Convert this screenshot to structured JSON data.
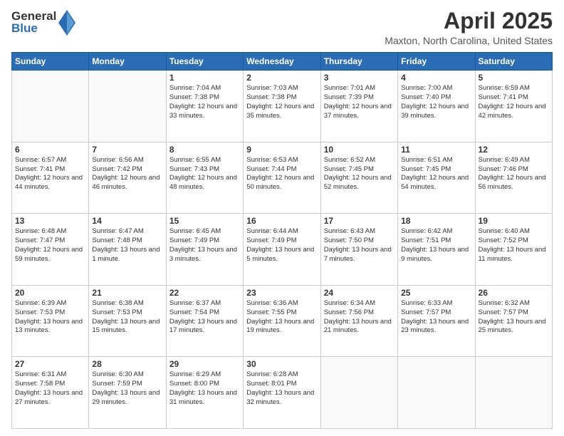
{
  "header": {
    "logo_general": "General",
    "logo_blue": "Blue",
    "title": "April 2025",
    "subtitle": "Maxton, North Carolina, United States"
  },
  "days_of_week": [
    "Sunday",
    "Monday",
    "Tuesday",
    "Wednesday",
    "Thursday",
    "Friday",
    "Saturday"
  ],
  "weeks": [
    [
      {
        "day": "",
        "info": ""
      },
      {
        "day": "",
        "info": ""
      },
      {
        "day": "1",
        "info": "Sunrise: 7:04 AM\nSunset: 7:38 PM\nDaylight: 12 hours and 33 minutes."
      },
      {
        "day": "2",
        "info": "Sunrise: 7:03 AM\nSunset: 7:38 PM\nDaylight: 12 hours and 35 minutes."
      },
      {
        "day": "3",
        "info": "Sunrise: 7:01 AM\nSunset: 7:39 PM\nDaylight: 12 hours and 37 minutes."
      },
      {
        "day": "4",
        "info": "Sunrise: 7:00 AM\nSunset: 7:40 PM\nDaylight: 12 hours and 39 minutes."
      },
      {
        "day": "5",
        "info": "Sunrise: 6:59 AM\nSunset: 7:41 PM\nDaylight: 12 hours and 42 minutes."
      }
    ],
    [
      {
        "day": "6",
        "info": "Sunrise: 6:57 AM\nSunset: 7:41 PM\nDaylight: 12 hours and 44 minutes."
      },
      {
        "day": "7",
        "info": "Sunrise: 6:56 AM\nSunset: 7:42 PM\nDaylight: 12 hours and 46 minutes."
      },
      {
        "day": "8",
        "info": "Sunrise: 6:55 AM\nSunset: 7:43 PM\nDaylight: 12 hours and 48 minutes."
      },
      {
        "day": "9",
        "info": "Sunrise: 6:53 AM\nSunset: 7:44 PM\nDaylight: 12 hours and 50 minutes."
      },
      {
        "day": "10",
        "info": "Sunrise: 6:52 AM\nSunset: 7:45 PM\nDaylight: 12 hours and 52 minutes."
      },
      {
        "day": "11",
        "info": "Sunrise: 6:51 AM\nSunset: 7:45 PM\nDaylight: 12 hours and 54 minutes."
      },
      {
        "day": "12",
        "info": "Sunrise: 6:49 AM\nSunset: 7:46 PM\nDaylight: 12 hours and 56 minutes."
      }
    ],
    [
      {
        "day": "13",
        "info": "Sunrise: 6:48 AM\nSunset: 7:47 PM\nDaylight: 12 hours and 59 minutes."
      },
      {
        "day": "14",
        "info": "Sunrise: 6:47 AM\nSunset: 7:48 PM\nDaylight: 13 hours and 1 minute."
      },
      {
        "day": "15",
        "info": "Sunrise: 6:45 AM\nSunset: 7:49 PM\nDaylight: 13 hours and 3 minutes."
      },
      {
        "day": "16",
        "info": "Sunrise: 6:44 AM\nSunset: 7:49 PM\nDaylight: 13 hours and 5 minutes."
      },
      {
        "day": "17",
        "info": "Sunrise: 6:43 AM\nSunset: 7:50 PM\nDaylight: 13 hours and 7 minutes."
      },
      {
        "day": "18",
        "info": "Sunrise: 6:42 AM\nSunset: 7:51 PM\nDaylight: 13 hours and 9 minutes."
      },
      {
        "day": "19",
        "info": "Sunrise: 6:40 AM\nSunset: 7:52 PM\nDaylight: 13 hours and 11 minutes."
      }
    ],
    [
      {
        "day": "20",
        "info": "Sunrise: 6:39 AM\nSunset: 7:53 PM\nDaylight: 13 hours and 13 minutes."
      },
      {
        "day": "21",
        "info": "Sunrise: 6:38 AM\nSunset: 7:53 PM\nDaylight: 13 hours and 15 minutes."
      },
      {
        "day": "22",
        "info": "Sunrise: 6:37 AM\nSunset: 7:54 PM\nDaylight: 13 hours and 17 minutes."
      },
      {
        "day": "23",
        "info": "Sunrise: 6:36 AM\nSunset: 7:55 PM\nDaylight: 13 hours and 19 minutes."
      },
      {
        "day": "24",
        "info": "Sunrise: 6:34 AM\nSunset: 7:56 PM\nDaylight: 13 hours and 21 minutes."
      },
      {
        "day": "25",
        "info": "Sunrise: 6:33 AM\nSunset: 7:57 PM\nDaylight: 13 hours and 23 minutes."
      },
      {
        "day": "26",
        "info": "Sunrise: 6:32 AM\nSunset: 7:57 PM\nDaylight: 13 hours and 25 minutes."
      }
    ],
    [
      {
        "day": "27",
        "info": "Sunrise: 6:31 AM\nSunset: 7:58 PM\nDaylight: 13 hours and 27 minutes."
      },
      {
        "day": "28",
        "info": "Sunrise: 6:30 AM\nSunset: 7:59 PM\nDaylight: 13 hours and 29 minutes."
      },
      {
        "day": "29",
        "info": "Sunrise: 6:29 AM\nSunset: 8:00 PM\nDaylight: 13 hours and 31 minutes."
      },
      {
        "day": "30",
        "info": "Sunrise: 6:28 AM\nSunset: 8:01 PM\nDaylight: 13 hours and 32 minutes."
      },
      {
        "day": "",
        "info": ""
      },
      {
        "day": "",
        "info": ""
      },
      {
        "day": "",
        "info": ""
      }
    ]
  ]
}
